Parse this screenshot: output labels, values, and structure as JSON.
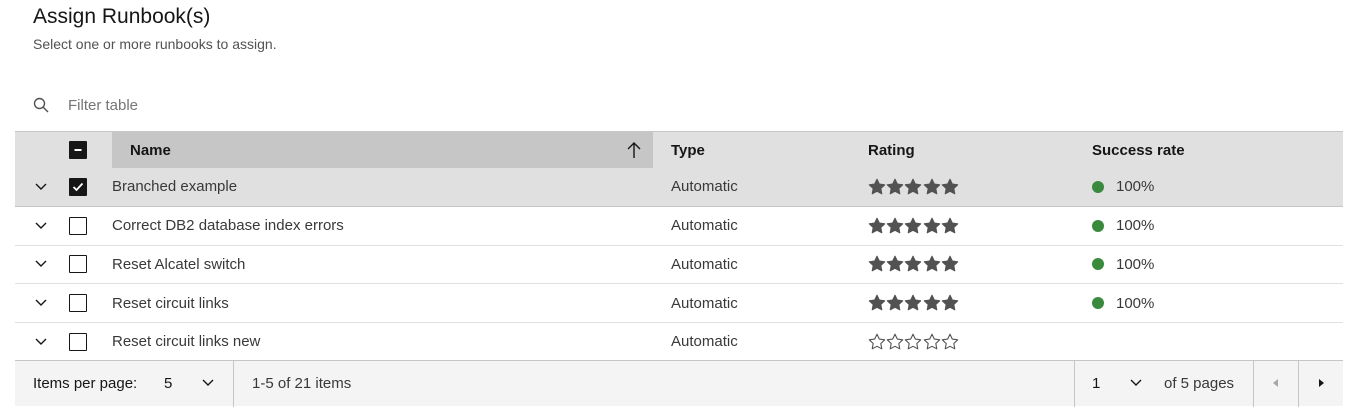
{
  "header": {
    "title": "Assign Runbook(s)",
    "subtitle": "Select one or more runbooks to assign."
  },
  "search": {
    "placeholder": "Filter table",
    "icon": "search-icon"
  },
  "table": {
    "columns": {
      "name": "Name",
      "type": "Type",
      "rating": "Rating",
      "success_rate": "Success rate"
    },
    "sort": {
      "column": "name",
      "direction": "ascending",
      "icon": "arrow-up-icon"
    },
    "select_all_state": "indeterminate",
    "rows": [
      {
        "name": "Branched example",
        "type": "Automatic",
        "rating": 5,
        "success_rate": "100%",
        "selected": true
      },
      {
        "name": "Correct DB2 database index errors",
        "type": "Automatic",
        "rating": 5,
        "success_rate": "100%",
        "selected": false
      },
      {
        "name": "Reset Alcatel switch",
        "type": "Automatic",
        "rating": 5,
        "success_rate": "100%",
        "selected": false
      },
      {
        "name": "Reset circuit links",
        "type": "Automatic",
        "rating": 5,
        "success_rate": "100%",
        "selected": false
      },
      {
        "name": "Reset circuit links new",
        "type": "Automatic",
        "rating": 0,
        "success_rate": "",
        "selected": false
      }
    ],
    "rating_max": 5
  },
  "pagination": {
    "items_per_page_label": "Items per page:",
    "items_per_page": "5",
    "range_text": "1-5 of 21 items",
    "current_page": "1",
    "of_pages_text": "of 5 pages"
  },
  "colors": {
    "header_bg": "#e0e0e0",
    "sorted_header_bg": "#c6c6c6",
    "selected_row_bg": "#e0e0e0",
    "star_filled": "#525252",
    "success_dot": "#398a3d"
  }
}
